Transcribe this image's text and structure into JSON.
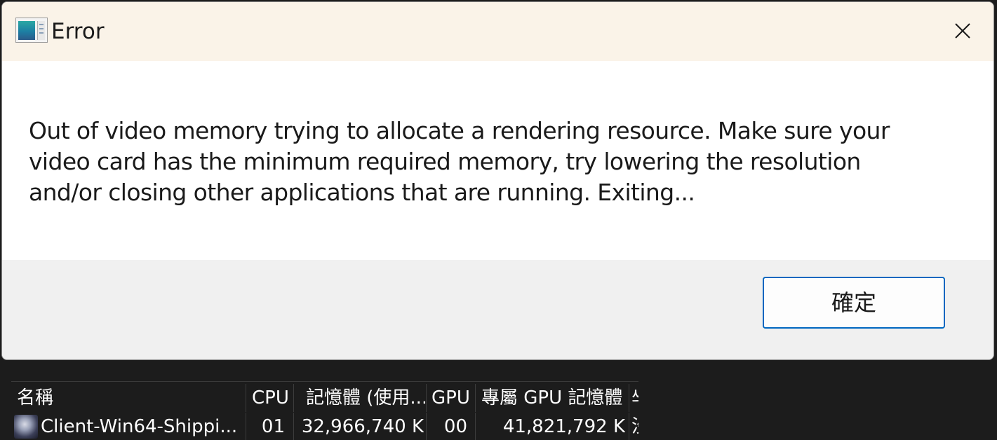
{
  "dialog": {
    "title": "Error",
    "close_symbol": "✕",
    "message": "Out of video memory trying to allocate a rendering resource. Make sure your\nvideo card has the minimum required memory, try lowering the resolution\nand/or closing other applications that are running. Exiting...",
    "ok_label": "確定",
    "icons": {
      "app": "application-window-icon",
      "close": "close-icon"
    },
    "colors": {
      "titlebar_bg": "#faf3e8",
      "footer_bg": "#f0f0f0",
      "button_border": "#0067c0"
    }
  },
  "task_manager": {
    "columns": {
      "name": "名稱",
      "cpu": "CPU",
      "memory": "記憶體 (使用...",
      "gpu": "GPU",
      "dedicated_gpu_memory": "專屬 GPU 記憶體",
      "next_partial": "씌"
    },
    "row": {
      "name": "Client-Win64-Shippi...",
      "cpu": "01",
      "memory": "32,966,740 K",
      "gpu": "00",
      "dedicated_gpu_memory": "41,821,792 K",
      "next_partial": "沒",
      "icon": "game-app-icon"
    },
    "colors": {
      "background": "#1c1c1c",
      "text": "#ffffff"
    }
  }
}
